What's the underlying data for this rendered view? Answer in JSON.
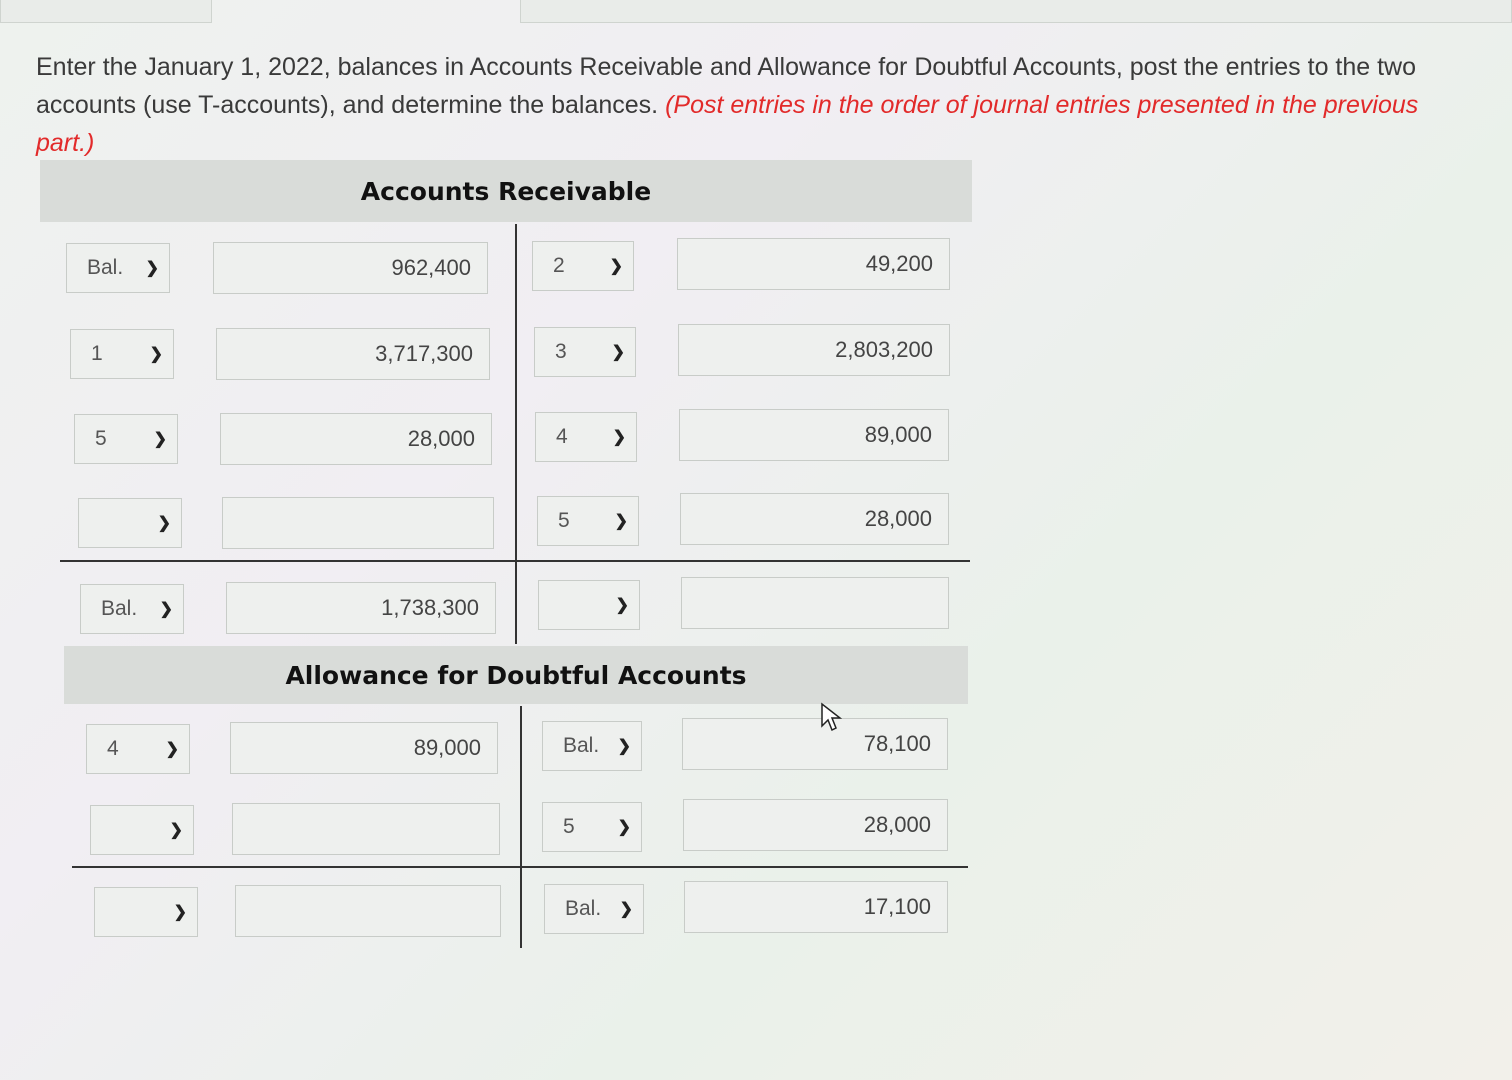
{
  "instructions": {
    "main_text": "Enter the January 1, 2022, balances in Accounts Receivable and Allowance for Doubtful Accounts, post the entries to the two accounts (use T-accounts), and determine the balances.",
    "note": "(Post entries in the order of journal entries presented in the previous part.)"
  },
  "accounts_receivable": {
    "title": "Accounts Receivable",
    "debit_rows": [
      {
        "select": "Bal.",
        "amount": "962,400"
      },
      {
        "select": "1",
        "amount": "3,717,300"
      },
      {
        "select": "5",
        "amount": "28,000"
      },
      {
        "select": "",
        "amount": ""
      }
    ],
    "credit_rows": [
      {
        "select": "2",
        "amount": "49,200"
      },
      {
        "select": "3",
        "amount": "2,803,200"
      },
      {
        "select": "4",
        "amount": "89,000"
      },
      {
        "select": "5",
        "amount": "28,000"
      }
    ],
    "balance_debit": {
      "select": "Bal.",
      "amount": "1,738,300"
    },
    "balance_credit": {
      "select": "",
      "amount": ""
    }
  },
  "allowance": {
    "title": "Allowance for Doubtful Accounts",
    "debit_rows": [
      {
        "select": "4",
        "amount": "89,000"
      },
      {
        "select": "",
        "amount": ""
      }
    ],
    "credit_rows": [
      {
        "select": "Bal.",
        "amount": "78,100"
      },
      {
        "select": "5",
        "amount": "28,000"
      }
    ],
    "balance_debit": {
      "select": "",
      "amount": ""
    },
    "balance_credit": {
      "select": "Bal.",
      "amount": "17,100"
    }
  },
  "icons": {
    "dropdown": "chevron-down-icon",
    "cursor": "mouse-pointer-icon"
  }
}
